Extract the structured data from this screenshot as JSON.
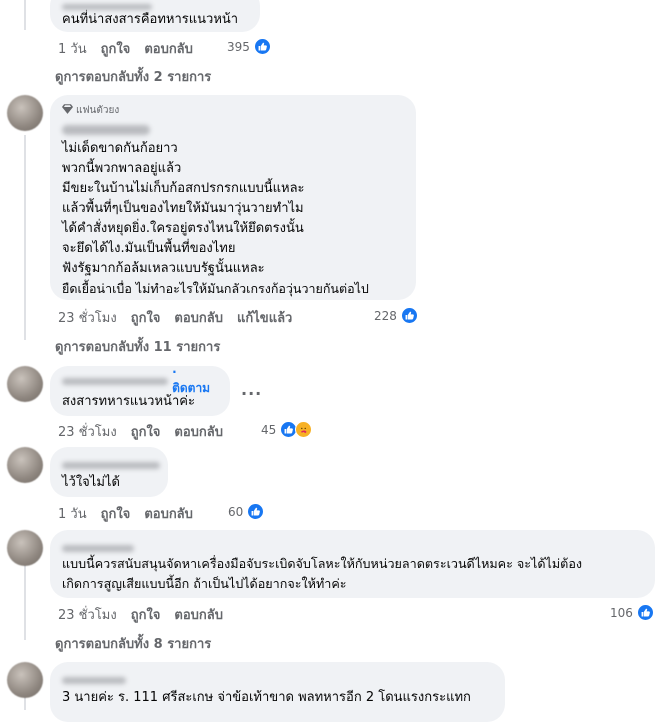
{
  "comments": [
    {
      "text_lines": [
        "คนที่น่าสงสารคือทหารแนวหน้า"
      ],
      "time": "1 วัน",
      "like": "ถูกใจ",
      "reply": "ตอบกลับ",
      "reaction_count": "395"
    },
    {
      "badge": "แฟนตัวยง",
      "text_lines": [
        "ไม่เด็ดขาดกันก้อยาว",
        "พวกนี้พวกพาลอยู่แล้ว",
        "มีขยะในบ้านไม่เก็บก้อสกปรกรกแบบนี้แหละ",
        "แล้วพื้นที่ๆเป็นของไทยให้มันมาวุ่นวายทำไม",
        "ได้คำสั่งหยุดยิ่ง.ใครอยู่ตรงไหนให้ยึดตรงนั้น",
        "จะยึดได้ไง.มันเป็นพื้นที่ของไทย",
        "ฟังรัฐมากก้อล้มเหลวแบบรัฐนั้นแหละ",
        "ยืดเยื้อน่าเบื่อ ไม่ทำอะไรให้มันกลัวเกรงก้อวุ่นวายกันต่อไป"
      ],
      "time": "23 ชั่วโมง",
      "like": "ถูกใจ",
      "reply": "ตอบกลับ",
      "edited": "แก้ไขแล้ว",
      "reaction_count": "228"
    },
    {
      "follow": "· ติดตาม",
      "text_lines": [
        "สงสารทหารแนวหน้าค่ะ"
      ],
      "time": "23 ชั่วโมง",
      "like": "ถูกใจ",
      "reply": "ตอบกลับ",
      "reaction_count": "45"
    },
    {
      "text_lines": [
        "ไว้ใจไม่ได้"
      ],
      "time": "1 วัน",
      "like": "ถูกใจ",
      "reply": "ตอบกลับ",
      "reaction_count": "60"
    },
    {
      "text_lines": [
        "แบบนี้ควรสนับสนุนจัดหาเครื่องมือจับระเบิดจับโลหะให้กับหน่วยลาดตระเวนดีไหมคะ จะได้ไม่ต้อง",
        "เกิดการสูญเสียแบบนี้อีก ถ้าเป็นไปได้อยากจะให้ทำค่ะ"
      ],
      "time": "23 ชั่วโมง",
      "like": "ถูกใจ",
      "reply": "ตอบกลับ",
      "reaction_count": "106"
    },
    {
      "text_lines": [
        "3 นายค่ะ ร. 111 ศรีสะเกษ จ่าข้อเท้าขาด พลทหารอีก 2 โดนแรงกระแทก"
      ]
    }
  ],
  "view_replies": [
    "ดูการตอบกลับทั้ง 2 รายการ",
    "ดูการตอบกลับทั้ง 11 รายการ",
    "ดูการตอบกลับทั้ง 8 รายการ"
  ],
  "more_options": "...",
  "icons": {
    "like": "thumbs-up-icon",
    "care": "care-hug-icon",
    "badge": "diamond-icon"
  },
  "colors": {
    "accent": "#1877f2",
    "bubble": "#f0f2f5",
    "muted": "#65676b"
  }
}
